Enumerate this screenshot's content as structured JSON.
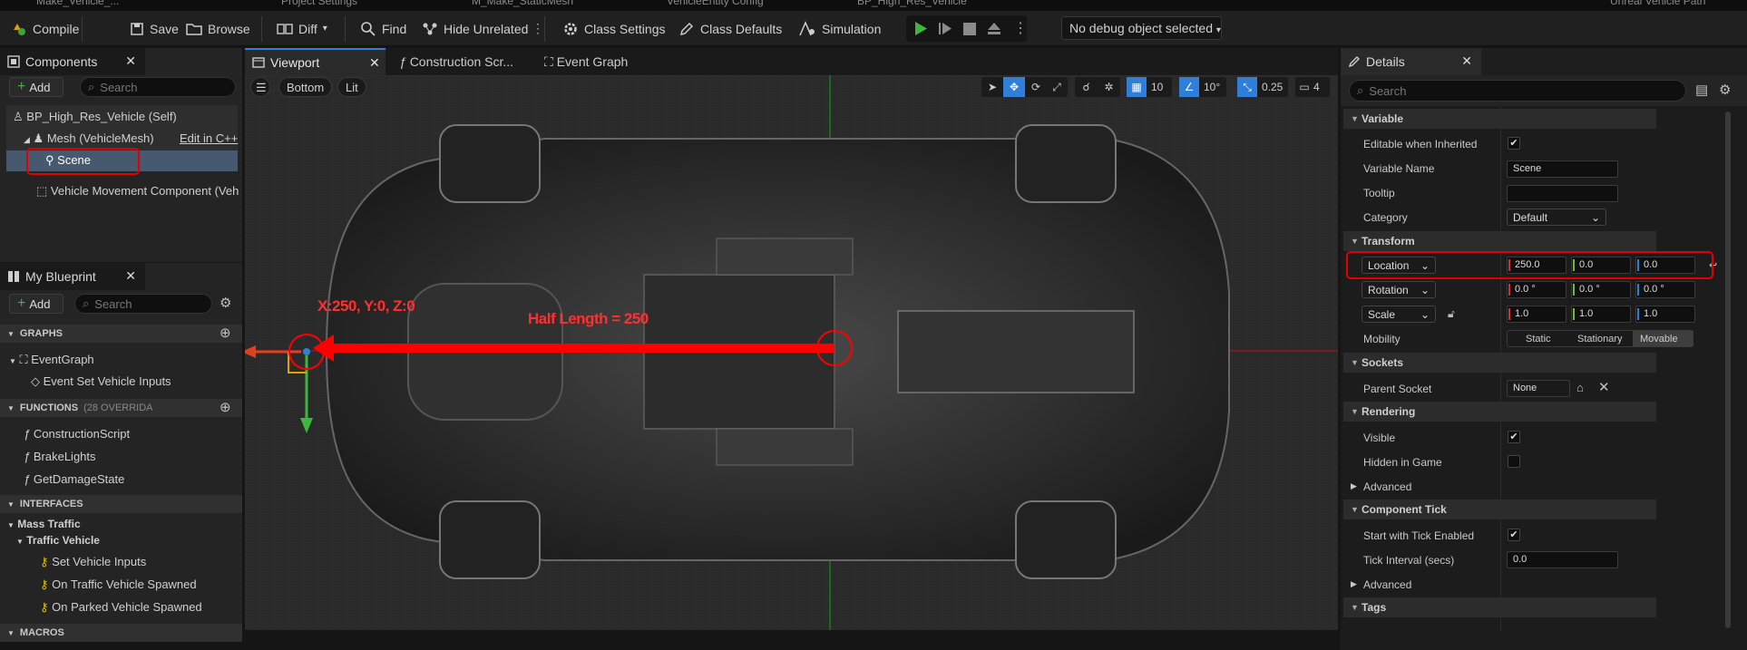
{
  "top_tabs": [
    "Make_Vehicle_...",
    "Project Settings",
    "M_Make_StaticMesh",
    "VehicleEntity Config",
    "BP_High_Res_Vehicle",
    "Unreal Vehicle Path"
  ],
  "toolbar": {
    "compile": "Compile",
    "save": "Save",
    "browse": "Browse",
    "diff": "Diff",
    "find": "Find",
    "hide_unrelated": "Hide Unrelated",
    "class_settings": "Class Settings",
    "class_defaults": "Class Defaults",
    "simulation": "Simulation",
    "debug_object": "No debug object selected"
  },
  "components_panel": {
    "title": "Components",
    "add": "Add",
    "search_placeholder": "Search",
    "items": [
      {
        "label": "BP_High_Res_Vehicle (Self)"
      },
      {
        "label": "Mesh (VehicleMesh)",
        "action": "Edit in C++"
      },
      {
        "label": "Scene"
      },
      {
        "label": "Vehicle Movement Component (Veh"
      }
    ]
  },
  "blueprint_panel": {
    "title": "My Blueprint",
    "add": "Add",
    "search_placeholder": "Search",
    "graphs_header": "GRAPHS",
    "event_graph": "EventGraph",
    "event_item": "Event Set Vehicle Inputs",
    "functions_header": "FUNCTIONS",
    "functions_count": "(28 OVERRIDA",
    "functions": [
      "ConstructionScript",
      "BrakeLights",
      "GetDamageState"
    ],
    "interfaces_header": "INTERFACES",
    "interface_group": "Mass Traffic",
    "interface_sub": "Traffic Vehicle",
    "interface_items": [
      "Set Vehicle Inputs",
      "On Traffic Vehicle Spawned",
      "On Parked Vehicle Spawned"
    ],
    "macros_header": "MACROS"
  },
  "viewport": {
    "tabs": [
      "Viewport",
      "Construction Scr...",
      "Event Graph"
    ],
    "view_mode": "Bottom",
    "lit": "Lit",
    "grid_snap": "10",
    "rot_snap": "10°",
    "scale_snap": "0.25",
    "cam_speed": "4",
    "annotation_coord": "X:250, Y:0, Z:0",
    "annotation_half": "Half Length = 250"
  },
  "details": {
    "title": "Details",
    "search_placeholder": "Search",
    "variable_header": "Variable",
    "editable_label": "Editable when Inherited",
    "var_name_label": "Variable Name",
    "var_name": "Scene",
    "tooltip_label": "Tooltip",
    "category_label": "Category",
    "category": "Default",
    "transform_header": "Transform",
    "location_label": "Location",
    "location": [
      "250.0",
      "0.0",
      "0.0"
    ],
    "rotation_label": "Rotation",
    "rotation": [
      "0.0 °",
      "0.0 °",
      "0.0 °"
    ],
    "scale_label": "Scale",
    "scale": [
      "1.0",
      "1.0",
      "1.0"
    ],
    "mobility_label": "Mobility",
    "mobility_options": [
      "Static",
      "Stationary",
      "Movable"
    ],
    "sockets_header": "Sockets",
    "parent_socket_label": "Parent Socket",
    "parent_socket": "None",
    "rendering_header": "Rendering",
    "visible_label": "Visible",
    "hidden_label": "Hidden in Game",
    "advanced": "Advanced",
    "tick_header": "Component Tick",
    "start_tick_label": "Start with Tick Enabled",
    "tick_interval_label": "Tick Interval (secs)",
    "tick_interval": "0.0",
    "tags_header": "Tags"
  },
  "colors": {
    "accent_blue": "#2f7fd8",
    "highlight_red": "#ff0000",
    "play_green": "#3db83d"
  }
}
